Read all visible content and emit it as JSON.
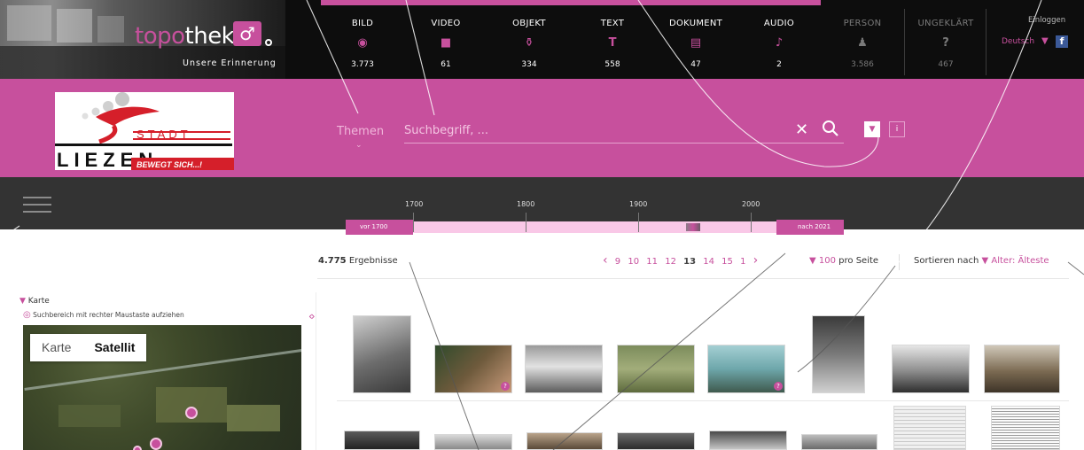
{
  "brand": {
    "name_part1": "topo",
    "name_part2": "thek",
    "tagline": "Unsere Erinnerung",
    "mark_icon": "topothek-logo-icon"
  },
  "categories": [
    {
      "label": "BILD",
      "icon": "◉",
      "count": "3.773"
    },
    {
      "label": "VIDEO",
      "icon": "■",
      "count": "61"
    },
    {
      "label": "OBJEKT",
      "icon": "⚱",
      "count": "334"
    },
    {
      "label": "TEXT",
      "icon": "T",
      "count": "558"
    },
    {
      "label": "DOKUMENT",
      "icon": "▤",
      "count": "47"
    },
    {
      "label": "AUDIO",
      "icon": "♪",
      "count": "2"
    },
    {
      "label": "PERSON",
      "icon": "♟",
      "count": "3.586"
    },
    {
      "label": "UNGEKLÄRT",
      "icon": "?",
      "count": "467"
    }
  ],
  "account": {
    "login": "Einloggen",
    "language": "Deutsch",
    "facebook": "f"
  },
  "city_logo": {
    "word1": "STADT",
    "word2": "LIEZEN",
    "slogan": "BEWEGT SICH...!"
  },
  "search": {
    "themen": "Themen",
    "placeholder": "Suchbegriff, ...",
    "clear": "✕",
    "info": "i"
  },
  "timeline": {
    "years": [
      "1700",
      "1800",
      "1900",
      "2000"
    ],
    "before_label": "vor 1700",
    "after_label": "nach 2021"
  },
  "results": {
    "count": "4.775",
    "count_label": "Ergebnisse",
    "pages": [
      "9",
      "10",
      "11",
      "12",
      "13",
      "14",
      "15",
      "1"
    ],
    "current_page": "13",
    "per_page": "100",
    "per_page_label": "pro Seite",
    "sort_label": "Sortieren nach",
    "sort_value": "Alter: Älteste"
  },
  "map": {
    "toggle_label": "Karte",
    "hint": "Suchbereich mit rechter Maustaste aufziehen",
    "type_map": "Karte",
    "type_satellite": "Satellit"
  },
  "colors": {
    "accent": "#c7509d",
    "dark": "#333333",
    "black": "#0d0d0d"
  }
}
